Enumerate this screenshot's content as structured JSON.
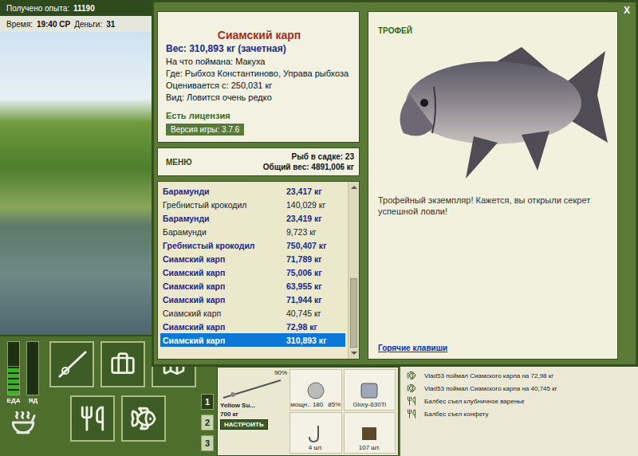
{
  "status": {
    "experience_label": "Получено опыта:",
    "experience": "11190",
    "time_label": "Время:",
    "time": "19:40 СР",
    "money_label": "Деньги:",
    "money": "31"
  },
  "dialog": {
    "close": "X",
    "fish": {
      "name": "Сиамский карп",
      "weight": "Вес: 310,893 кг (зачетная)",
      "details": [
        "На что поймана: Макуха",
        "Где: Рыбхоз Константиново, Управа рыбхоза",
        "Оценивается с: 250,031 кг",
        "Вид: Ловится очень редко"
      ]
    },
    "license": "Есть лицензия",
    "version": "Версия игры: 3.7.6",
    "menu": "МЕНЮ",
    "keep_count": "Рыб в садке: 23",
    "total_weight": "Общий вес: 4891,006 кг",
    "catches": [
      {
        "name": "Барамунди",
        "weight": "23,417 кг",
        "scored": true,
        "selected": false
      },
      {
        "name": "Гребнистый крокодил",
        "weight": "140,029 кг",
        "scored": false,
        "selected": false
      },
      {
        "name": "Барамунди",
        "weight": "23,419 кг",
        "scored": true,
        "selected": false
      },
      {
        "name": "Барамунди",
        "weight": "9,723 кг",
        "scored": false,
        "selected": false
      },
      {
        "name": "Гребнистый крокодил",
        "weight": "750,407 кг",
        "scored": true,
        "selected": false
      },
      {
        "name": "Сиамский карп",
        "weight": "71,789 кг",
        "scored": true,
        "selected": false
      },
      {
        "name": "Сиамский карп",
        "weight": "75,006 кг",
        "scored": true,
        "selected": false
      },
      {
        "name": "Сиамский карп",
        "weight": "63,955 кг",
        "scored": true,
        "selected": false
      },
      {
        "name": "Сиамский карп",
        "weight": "71,944 кг",
        "scored": true,
        "selected": false
      },
      {
        "name": "Сиамский карп",
        "weight": "40,745 кг",
        "scored": false,
        "selected": false
      },
      {
        "name": "Сиамский карп",
        "weight": "72,98 кг",
        "scored": true,
        "selected": false
      },
      {
        "name": "Сиамский карп",
        "weight": "310,893 кг",
        "scored": true,
        "selected": true
      }
    ],
    "scrollbar": {
      "level": 1
    },
    "trophy": {
      "label": "ТРОФЕЙ",
      "text": "Трофейный экземпляр! Кажется, вы открыли секрет успешной ловли!"
    },
    "hotkeys": "Горячие клавиши"
  },
  "meters": [
    {
      "label": "ЕДА",
      "level": 0.55,
      "color": "#3fae2a"
    },
    {
      "label": "ЯД",
      "level": 0,
      "color": "#c0392b"
    }
  ],
  "slots": [
    {
      "label": "1",
      "selected": true
    },
    {
      "label": "2",
      "selected": false
    },
    {
      "label": "3",
      "selected": false
    }
  ],
  "tackle": {
    "rod": {
      "name": "Yellow Su...",
      "capacity": "700 кг",
      "wear": "90%"
    },
    "reel": {
      "power": "мощн.: 180",
      "wear": "85%"
    },
    "line": {
      "name": "Glory-630Ti"
    },
    "hook": {
      "count": "4 шт."
    },
    "bait": {
      "count": "107 шт."
    },
    "setup": "НАСТРОИТЬ"
  },
  "log": [
    {
      "text": "Vlad53 поймал Сиамского карпа на 72,98 кг",
      "kind": "catch"
    },
    {
      "text": "Vlad53 поймал Сиамского карпа на 40,745 кг",
      "kind": "catch"
    },
    {
      "text": "Балбес съел клубничное варенье",
      "kind": "eat"
    },
    {
      "text": "Балбес съел конфету",
      "kind": "eat"
    }
  ]
}
